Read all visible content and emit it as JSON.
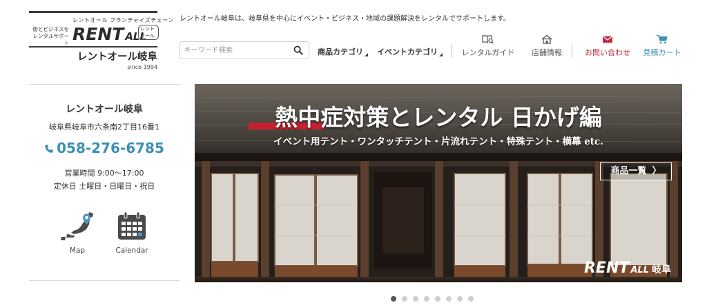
{
  "logo": {
    "tagline": "レントオール フランチャイズチェーン",
    "left_copy_1": "街とビジネスを",
    "left_copy_2": "レンタルサポート",
    "brand_main": "RENT",
    "brand_all": "ALL",
    "badge": "レントオール",
    "name": "レントオール岐阜",
    "since": "since 1994"
  },
  "header": {
    "note": "レントオール岐阜は、岐阜県を中心にイベント・ビジネス・地域の課題解決をレンタルでサポートします。",
    "search_placeholder": "キーワード検索",
    "categories": [
      "商品カテゴリ",
      "イベントカテゴリ"
    ],
    "links": {
      "guide": "レンタルガイド",
      "store": "店舗情報",
      "contact": "お問い合わせ",
      "cart": "見積カート"
    }
  },
  "sidebar": {
    "store_name": "レントオール岐阜",
    "address": "岐阜県岐阜市六条南2丁目16番1",
    "phone": "058-276-6785",
    "hours": "営業時間 9:00〜17:00",
    "closed": "定休日 土曜日・日曜日・祝日",
    "map_label": "Map",
    "calendar_label": "Calendar"
  },
  "hero": {
    "title": "熱中症対策とレンタル 日かげ編",
    "subtitle": "イベント用テント・ワンタッチテント・片流れテント・特殊テント・横幕 etc.",
    "button": "商品一覧",
    "button_chevron": "〉",
    "watermark_rent": "RENT",
    "watermark_all": "ALL",
    "watermark_place": "岐阜"
  },
  "carousel": {
    "count": 8,
    "active_index": 0
  },
  "colors": {
    "phone": "#3b8fb7",
    "contact": "#c7283d",
    "cart": "#3e8fb8",
    "accent_red": "#c8202f"
  }
}
